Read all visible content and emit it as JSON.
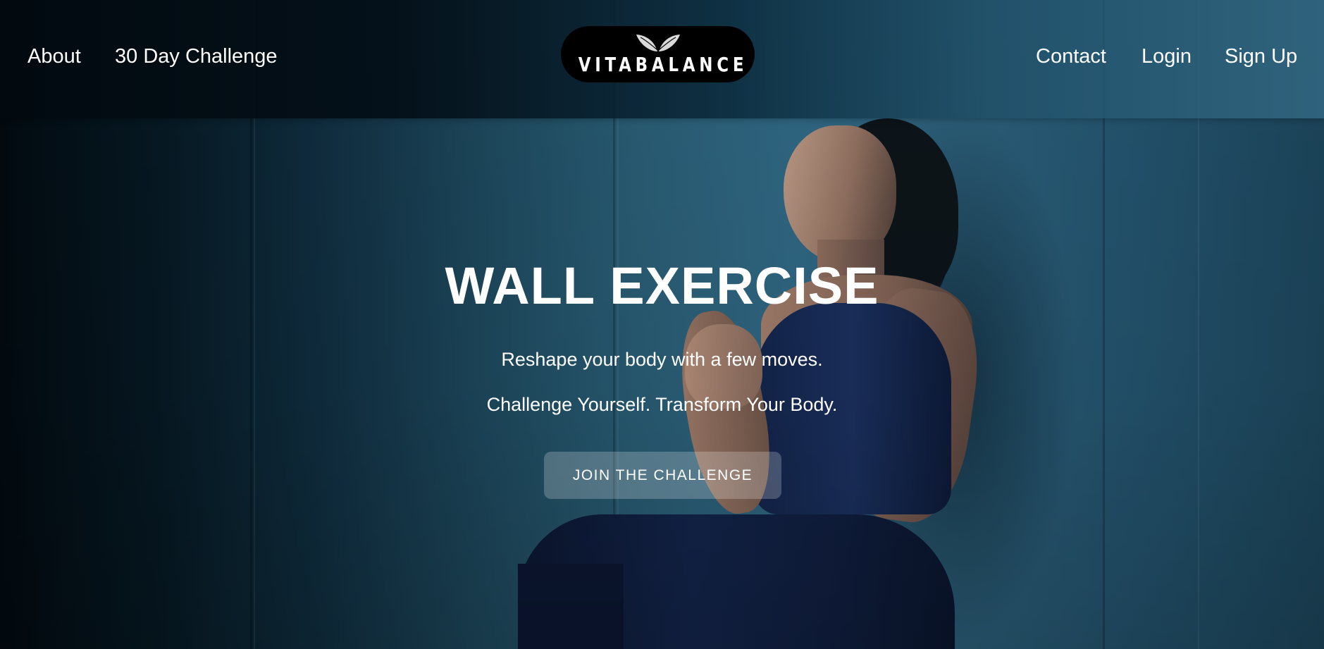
{
  "nav": {
    "left": [
      {
        "label": "About"
      },
      {
        "label": "30 Day Challenge"
      }
    ],
    "right": [
      {
        "label": "Contact"
      },
      {
        "label": "Login"
      },
      {
        "label": "Sign Up"
      }
    ]
  },
  "logo": {
    "text": "VITABALANCE",
    "icon": "leaves-icon"
  },
  "hero": {
    "title": "WALL EXERCISE",
    "subtitle_1": "Reshape your body with a few moves.",
    "subtitle_2": "Challenge Yourself. Transform Your Body.",
    "cta_label": "JOIN THE CHALLENGE",
    "image": "woman doing wall sit exercise against concrete wall"
  },
  "colors": {
    "header_dark": "#020a10",
    "header_light": "#346a85",
    "text": "#ffffff",
    "logo_bg": "#000000"
  }
}
